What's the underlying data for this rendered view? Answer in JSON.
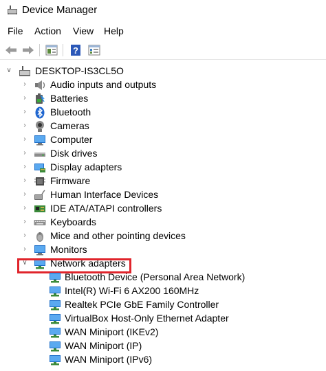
{
  "window": {
    "title": "Device Manager",
    "title_icon": "device-manager-icon"
  },
  "menu": [
    {
      "label": "File"
    },
    {
      "label": "Action"
    },
    {
      "label": "View"
    },
    {
      "label": "Help"
    }
  ],
  "toolbar": {
    "buttons": [
      "back-arrow-icon",
      "forward-arrow-icon",
      "properties-icon",
      "help-icon",
      "update-view-icon"
    ]
  },
  "tree": {
    "root": {
      "label": "DESKTOP-IS3CL5O",
      "expanded": true,
      "icon": "computer-icon"
    },
    "categories": [
      {
        "label": "Audio inputs and outputs",
        "icon": "speaker-icon"
      },
      {
        "label": "Batteries",
        "icon": "battery-icon"
      },
      {
        "label": "Bluetooth",
        "icon": "bluetooth-icon"
      },
      {
        "label": "Cameras",
        "icon": "camera-icon"
      },
      {
        "label": "Computer",
        "icon": "monitor-icon"
      },
      {
        "label": "Disk drives",
        "icon": "disk-drive-icon"
      },
      {
        "label": "Display adapters",
        "icon": "display-adapter-icon"
      },
      {
        "label": "Firmware",
        "icon": "firmware-icon"
      },
      {
        "label": "Human Interface Devices",
        "icon": "hid-icon"
      },
      {
        "label": "IDE ATA/ATAPI controllers",
        "icon": "ide-controller-icon"
      },
      {
        "label": "Keyboards",
        "icon": "keyboard-icon"
      },
      {
        "label": "Mice and other pointing devices",
        "icon": "mouse-icon"
      },
      {
        "label": "Monitors",
        "icon": "monitor-icon"
      },
      {
        "label": "Network adapters",
        "icon": "network-adapter-icon",
        "expanded": true,
        "highlighted": true
      }
    ],
    "network_adapters": [
      {
        "label": "Bluetooth Device (Personal Area Network)"
      },
      {
        "label": "Intel(R) Wi-Fi 6 AX200 160MHz"
      },
      {
        "label": "Realtek PCIe GbE Family Controller"
      },
      {
        "label": "VirtualBox Host-Only Ethernet Adapter"
      },
      {
        "label": "WAN Miniport (IKEv2)"
      },
      {
        "label": "WAN Miniport (IP)"
      },
      {
        "label": "WAN Miniport (IPv6)"
      }
    ]
  },
  "colors": {
    "highlight_border": "#e0242b",
    "network_icon": "#2a8de0"
  }
}
